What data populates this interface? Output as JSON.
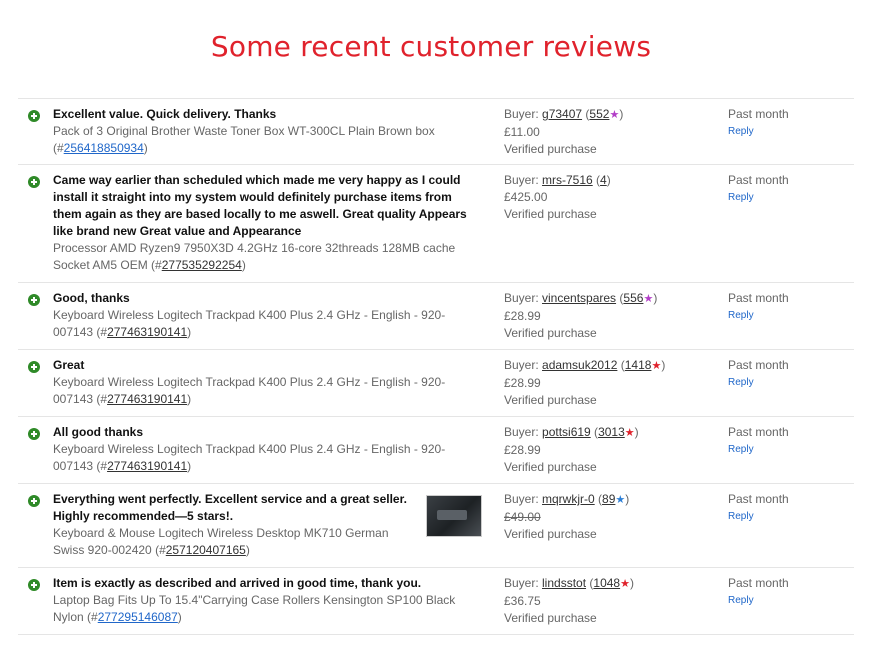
{
  "title": "Some recent customer reviews",
  "colors": {
    "title": "#e0222c",
    "link": "#2067c9",
    "positive": "#2f8a28",
    "star_purple": "#b23ec7",
    "star_red": "#e0222c",
    "star_blue": "#2d7fd6"
  },
  "reviews": [
    {
      "comment": "Excellent value. Quick delivery. Thanks",
      "item": "Pack of 3 Original Brother Waste Toner Box WT-300CL Plain Brown box",
      "item_id": "256418850934",
      "buyer": "g73407",
      "feedback": "552",
      "star": "★",
      "price": "£11.00",
      "verified": "Verified purchase",
      "date": "Past month",
      "reply": "Reply"
    },
    {
      "comment": "Came way earlier than scheduled which made me very happy as I could install it straight into my system would definitely purchase items from them again as they are based locally to me aswell. Great quality Appears like brand new Great value and Appearance",
      "item": "Processor AMD Ryzen9 7950X3D 4.2GHz 16-core 32threads 128MB cache Socket AM5 OEM",
      "item_id": "277535292254",
      "buyer": "mrs-7516",
      "feedback": "4",
      "price": "£425.00",
      "verified": "Verified purchase",
      "date": "Past month",
      "reply": "Reply"
    },
    {
      "comment": "Good, thanks",
      "item": "Keyboard Wireless Logitech Trackpad K400 Plus 2.4 GHz - English - 920-007143",
      "item_id": "277463190141",
      "buyer": "vincentspares",
      "feedback": "556",
      "star": "★",
      "price": "£28.99",
      "verified": "Verified purchase",
      "date": "Past month",
      "reply": "Reply"
    },
    {
      "comment": "Great",
      "item": "Keyboard Wireless Logitech Trackpad K400 Plus 2.4 GHz - English - 920-007143",
      "item_id": "277463190141",
      "buyer": "adamsuk2012",
      "feedback": "1418",
      "star": "★",
      "price": "£28.99",
      "verified": "Verified purchase",
      "date": "Past month",
      "reply": "Reply"
    },
    {
      "comment": "All good thanks",
      "item": "Keyboard Wireless Logitech Trackpad K400 Plus 2.4 GHz - English - 920-007143",
      "item_id": "277463190141",
      "buyer": "pottsi619",
      "feedback": "3013",
      "star": "★",
      "price": "£28.99",
      "verified": "Verified purchase",
      "date": "Past month",
      "reply": "Reply"
    },
    {
      "comment": "Everything went perfectly. Excellent service and a great seller. Highly recommended—5 stars!.",
      "item": "Keyboard & Mouse Logitech Wireless Desktop MK710 German Swiss 920-002420",
      "item_id": "257120407165",
      "buyer": "mqrwkjr-0",
      "feedback": "89",
      "star": "★",
      "price": "£49.00",
      "verified": "Verified purchase",
      "date": "Past month",
      "reply": "Reply"
    },
    {
      "comment": "Item is exactly as described and arrived in good time, thank you.",
      "item": "Laptop Bag Fits Up To 15.4\"Carrying Case Rollers Kensington SP100 Black Nylon",
      "item_id": "277295146087",
      "buyer": "lindsstot",
      "feedback": "1048",
      "star": "★",
      "price": "£36.75",
      "verified": "Verified purchase",
      "date": "Past month",
      "reply": "Reply"
    }
  ]
}
